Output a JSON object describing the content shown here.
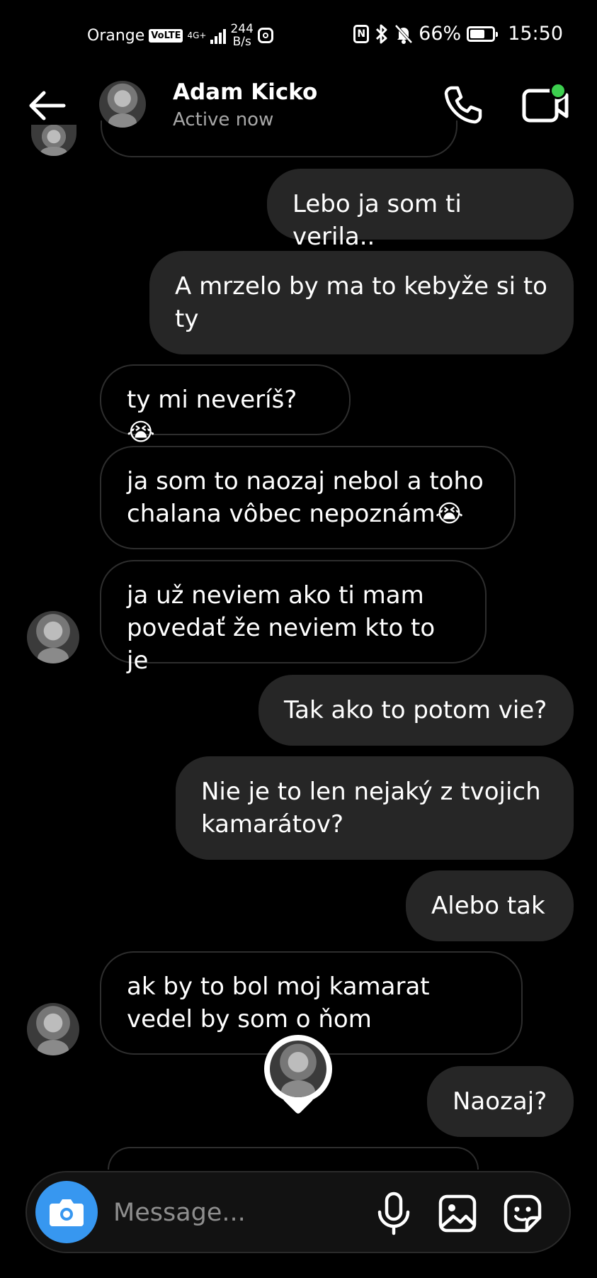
{
  "status_bar": {
    "carrier": "Orange",
    "volte": "VoLTE",
    "network": "4G+",
    "speed_value": "244",
    "speed_unit": "B/s",
    "nfc": "N",
    "battery": "66%",
    "battery_level": 0.66,
    "time": "15:50"
  },
  "header": {
    "name": "Adam Kicko",
    "status": "Active now",
    "online_color": "#3ccf4e"
  },
  "messages": [
    {
      "side": "out",
      "text": "Lebo ja som ti verila.."
    },
    {
      "side": "out",
      "text": "A mrzelo by ma to kebyže si to ty"
    },
    {
      "side": "in",
      "text": "ty mi neveríš?😭"
    },
    {
      "side": "in",
      "text": "ja som to naozaj nebol a toho chalana vôbec nepoznám😭"
    },
    {
      "side": "in",
      "text": "ja už neviem ako ti mam povedať že neviem kto to je"
    },
    {
      "side": "out",
      "text": "Tak ako to potom vie?"
    },
    {
      "side": "out",
      "text": "Nie je to len nejaký z tvojich kamarátov?"
    },
    {
      "side": "out",
      "text": "Alebo tak"
    },
    {
      "side": "in",
      "text": "ak by to bol moj kamarat vedel by som o ňom"
    },
    {
      "side": "out",
      "text": "Naozaj?"
    }
  ],
  "composer": {
    "placeholder": "Message..."
  },
  "icons": {
    "back": "arrow-left",
    "call": "phone",
    "video": "video-camera",
    "camera": "camera",
    "mic": "microphone",
    "gallery": "image",
    "sticker": "sticker",
    "accent": "#3797f0"
  }
}
